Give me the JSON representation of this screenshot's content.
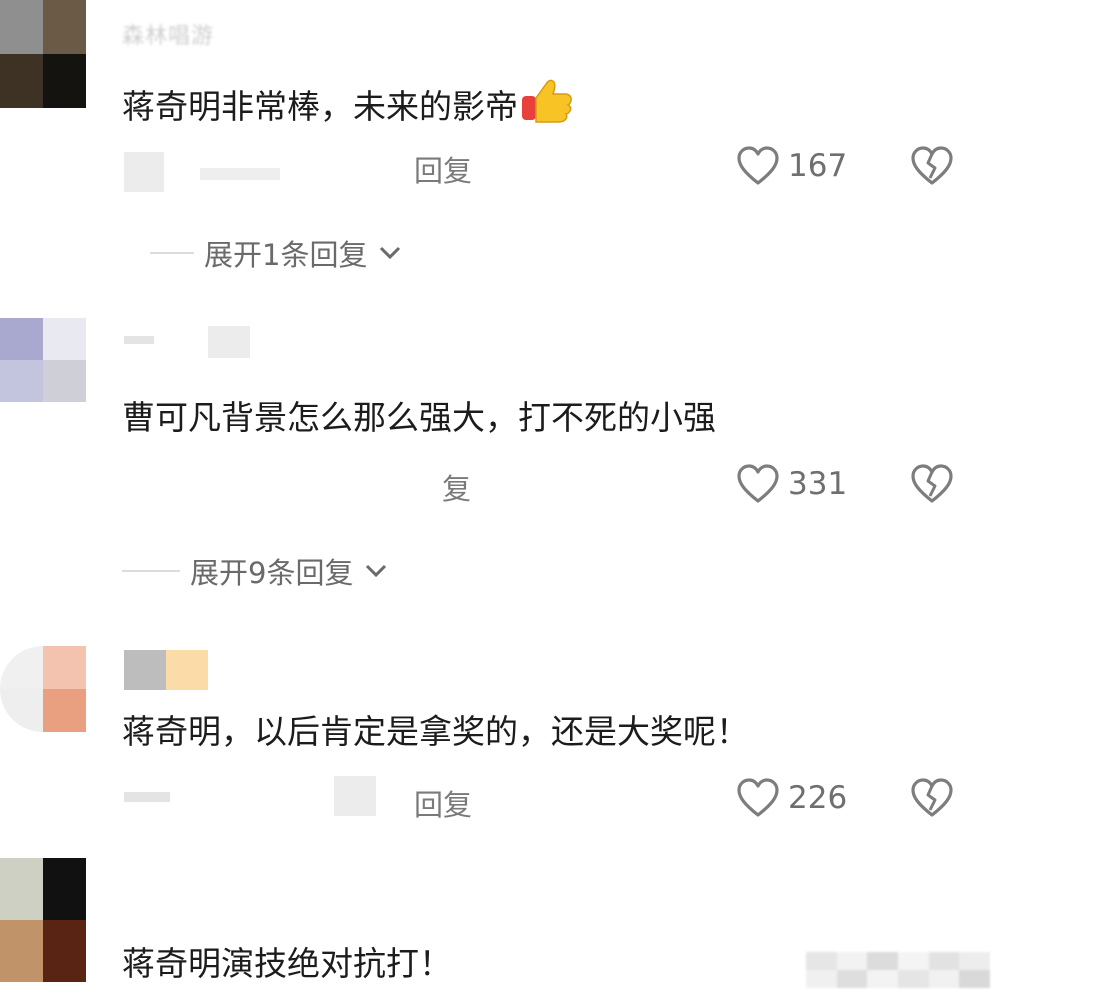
{
  "comments": [
    {
      "username": "森林唱游",
      "text": "蒋奇明非常棒，未来的影帝",
      "emoji": "👍",
      "reply_label": "回复",
      "likes": "167",
      "expand_label": "展开1条回复"
    },
    {
      "username": "",
      "text": "曹可凡背景怎么那么强大，打不死的小强",
      "reply_label": "复",
      "likes": "331",
      "expand_label": "展开9条回复"
    },
    {
      "username": "",
      "text": "蒋奇明，以后肯定是拿奖的，还是大奖呢！",
      "reply_label": "回复",
      "likes": "226"
    },
    {
      "username": "",
      "text": "蒋奇明演技绝对抗打！"
    }
  ],
  "colors": {
    "text": "#1c1c1c",
    "muted": "#7a7a7a",
    "icon_stroke": "#7d7d7d",
    "emoji_yellow": "#f7c325",
    "emoji_red": "#e8413c"
  },
  "icons": {
    "like": "heart-outline-icon",
    "dislike": "broken-heart-icon",
    "expand": "chevron-down-icon"
  }
}
